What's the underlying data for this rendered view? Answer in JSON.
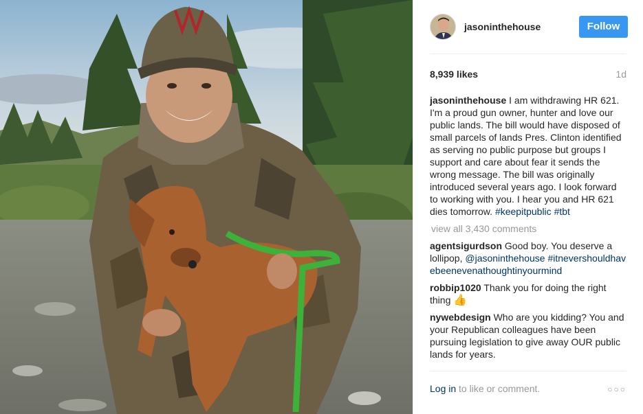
{
  "post": {
    "username": "jasoninthehouse",
    "follow_label": "Follow",
    "likes": "8,939 likes",
    "age": "1d"
  },
  "caption": {
    "user": "jasoninthehouse",
    "text": "I am withdrawing HR 621. I'm a proud gun owner, hunter and love our public lands. The bill would have disposed of small parcels of lands Pres. Clinton identified as serving no public purpose but groups I support and care about fear it sends the wrong message. The bill was originally introduced several years ago. I look forward to working with you. I hear you and HR 621 dies tomorrow.",
    "tag1": "#keepitpublic",
    "tag2": "#tbt"
  },
  "view_all": "view all 3,430 comments",
  "comments": [
    {
      "user": "agentsigurdson",
      "text": "Good boy. You deserve a lollipop,",
      "mention": "@jasoninthehouse",
      "tag": "#itnevershouldhavebeenevenathoughtinyourmind"
    },
    {
      "user": "robbip1020",
      "text": "Thank you for doing the right thing",
      "emoji": "👍"
    },
    {
      "user": "nywebdesign",
      "text": "Who are you kidding? You and your Republican colleagues have been pursuing legislation to give away OUR public lands for years."
    }
  ],
  "footer": {
    "login": "Log in",
    "rest": "to like or comment.",
    "more_icon": "more-options-icon"
  },
  "colors": {
    "follow_blue": "#3897f0",
    "link_navy": "#003569",
    "muted_gray": "#999999",
    "text_dark": "#262626"
  }
}
